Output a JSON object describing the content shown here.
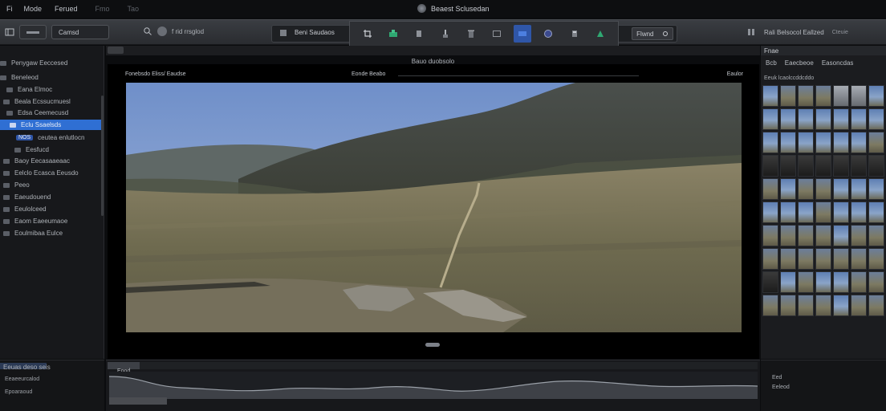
{
  "menubar": {
    "items": [
      "Fi",
      "Mode",
      "Ferued",
      "Fmo",
      "Tao"
    ],
    "app_title": "Beaest Sclusedan"
  },
  "toolbar": {
    "left_buttons": [
      "",
      "Camsd"
    ],
    "search_text": "f rid rrsglod",
    "center_label": "Beni Saudaos",
    "tool_labels": [
      "",
      "",
      "",
      "",
      "",
      "",
      "",
      "",
      "",
      ""
    ],
    "active_tool_index": 6,
    "right_box_label": "Flwnd",
    "right_text": "Rali Belsocol Eallzed",
    "right_extra": "Cteuie"
  },
  "sidebar": {
    "items": [
      {
        "label": "Penygaw Eeccesed",
        "selected": false,
        "chip": ""
      },
      {
        "label": "Beneleod",
        "selected": false,
        "chip": ""
      },
      {
        "label": "Eana   Elmoc",
        "selected": false,
        "chip": ""
      },
      {
        "label": "Beala Ecssucmuesl",
        "selected": false,
        "chip": ""
      },
      {
        "label": "Edsa Ceemecusd",
        "selected": false,
        "chip": ""
      },
      {
        "label": "Eclu Ssaelsds",
        "selected": true,
        "chip": ""
      },
      {
        "label": "ceutea   enlutlocn",
        "selected": false,
        "chip": "NOS"
      },
      {
        "label": "Eesfucd",
        "selected": false,
        "chip": ""
      },
      {
        "label": "Baoy   Eecasaaeaac",
        "selected": false,
        "chip": ""
      },
      {
        "label": "Eelclo Ecasca Eeusdo",
        "selected": false,
        "chip": ""
      },
      {
        "label": "Peeo",
        "selected": false,
        "chip": ""
      },
      {
        "label": "Eaeudouend",
        "selected": false,
        "chip": ""
      },
      {
        "label": "Eeulolceed",
        "selected": false,
        "chip": ""
      },
      {
        "label": "Eaom Eaeeumaoe",
        "selected": false,
        "chip": ""
      },
      {
        "label": "Eoulmibaa Eulce",
        "selected": false,
        "chip": ""
      }
    ]
  },
  "viewer": {
    "header_title": "Bauo duobsolo",
    "bar_left": "Fonebsdo Eliss/ Eaudse",
    "bar_center": "Eonde Beabo",
    "bar_right": "Eaulor"
  },
  "right_panel": {
    "tab": "Fnae",
    "tabs": [
      "Bcb",
      "Eaecbeoe",
      "Easoncdas"
    ],
    "subheader": "Eeuk lcaolccddcddo",
    "thumb_rows": [
      [
        "sky",
        "land",
        "land",
        "land",
        "grey",
        "grey",
        "sky"
      ],
      [
        "sky",
        "sky",
        "sky",
        "sky",
        "sky",
        "sky",
        "sky"
      ],
      [
        "sky",
        "sky",
        "sky",
        "sky",
        "sky",
        "sky",
        "land"
      ],
      [
        "dark",
        "dark",
        "dark",
        "dark",
        "dark",
        "dark",
        "dark"
      ],
      [
        "land",
        "sky",
        "land",
        "land",
        "sky",
        "sky",
        "sky"
      ],
      [
        "sky",
        "sky",
        "sky",
        "land",
        "sky",
        "sky",
        "sky"
      ],
      [
        "land",
        "land",
        "land",
        "land",
        "sky",
        "land",
        "land"
      ],
      [
        "land",
        "land",
        "land",
        "land",
        "land",
        "land",
        "land"
      ],
      [
        "dark",
        "sky",
        "land",
        "sky",
        "sky",
        "land",
        "land"
      ],
      [
        "land",
        "land",
        "land",
        "land",
        "sky",
        "land",
        "land"
      ]
    ]
  },
  "bottom_left": {
    "header": "Eeuas deso seis",
    "lines": [
      "Eeaeeurcalod",
      "Epoaraoud"
    ]
  },
  "timeline": {
    "label": "Eood"
  },
  "bottom_right": {
    "lines": [
      "Eed",
      "Eeleod"
    ]
  },
  "colors": {
    "accent": "#2f6fd3",
    "toolbar_active": "#2f56a8",
    "panel_bg": "#17181b",
    "viewer_bg": "#000000"
  }
}
